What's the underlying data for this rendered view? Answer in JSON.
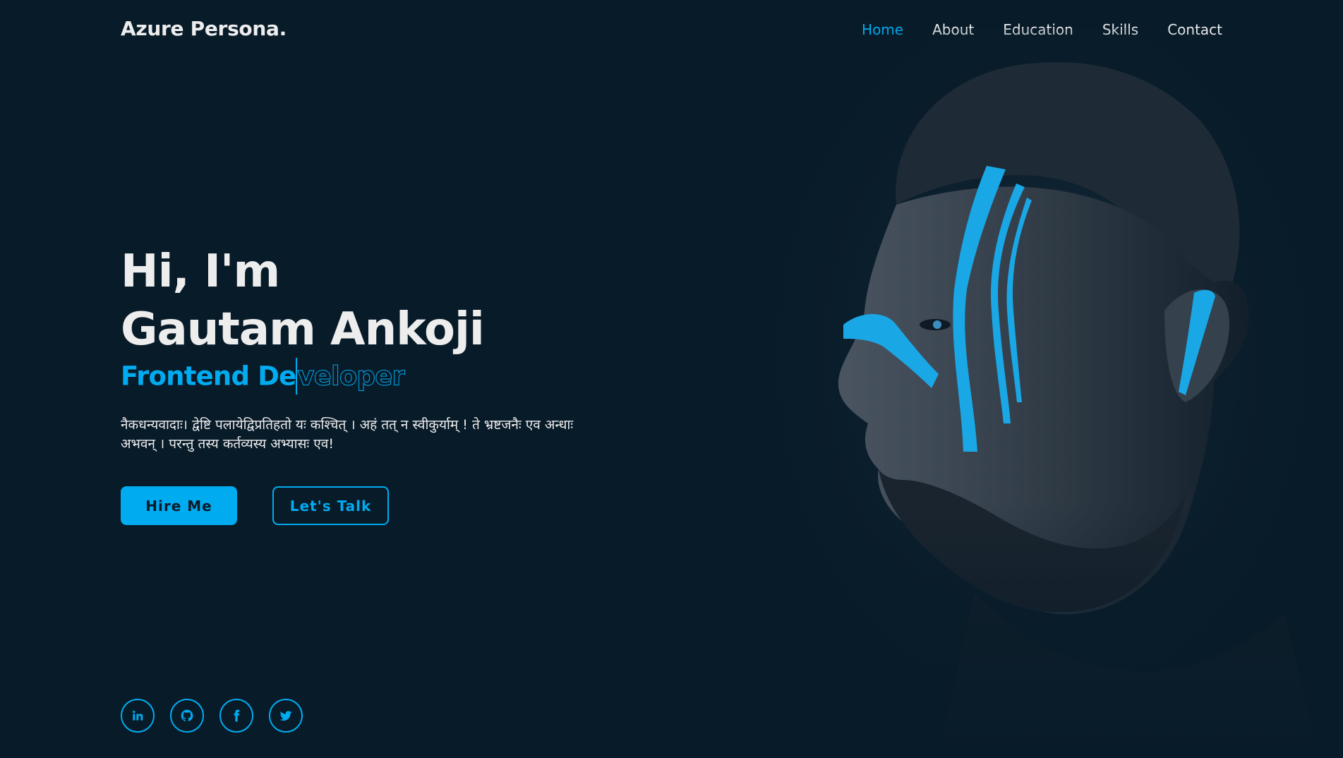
{
  "header": {
    "logo": "Azure Persona.",
    "nav": [
      "Home",
      "About",
      "Education",
      "Skills",
      "Contact"
    ],
    "active_nav": "Home"
  },
  "hero": {
    "greeting": "Hi, I'm",
    "name": "Gautam Ankoji",
    "role_typed": "Frontend De",
    "role_remaining": "veloper",
    "description": "नैकधन्यवादाः। द्वेष्टि पलायेद्विप्रतिहतो यः कश्चित् । अहं तत् न स्वीकुर्याम् ! ते भ्रष्टजनैः एव अन्धाः अभवन् । परन्तु तस्य कर्तव्यस्य अभ्यासः एव!",
    "hire_button": "Hire Me",
    "talk_button": "Let's Talk"
  },
  "socials": [
    "linkedin-icon",
    "github-icon",
    "facebook-icon",
    "twitter-icon"
  ],
  "colors": {
    "background": "#081b29",
    "accent": "#00abf0",
    "text": "#ededed"
  }
}
